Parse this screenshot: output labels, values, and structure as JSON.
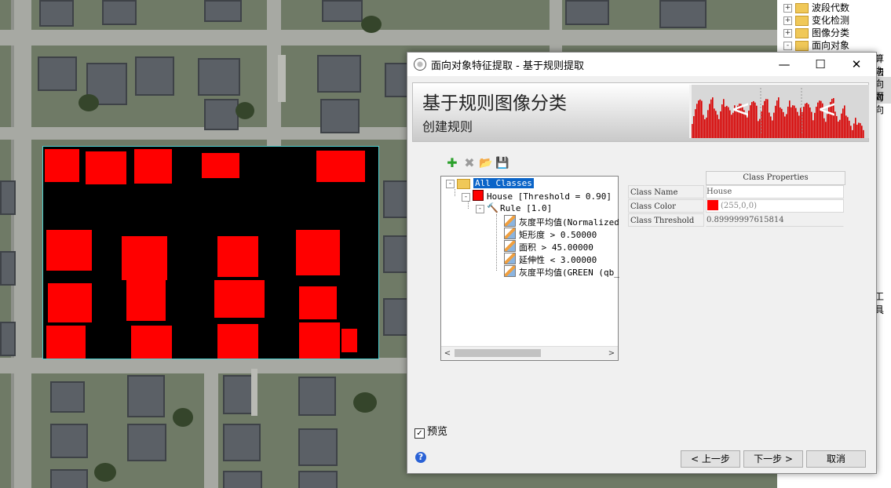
{
  "side_tree": {
    "items": [
      {
        "expander": "+",
        "label": "波段代数"
      },
      {
        "expander": "+",
        "label": "变化检测"
      },
      {
        "expander": "+",
        "label": "图像分类"
      },
      {
        "expander": "-",
        "label": "面向对象"
      }
    ],
    "fragments": [
      "算法",
      "向对",
      "向对",
      "面向",
      "工具"
    ]
  },
  "dialog": {
    "title": "面向对象特征提取 - 基于规则提取",
    "minimize": "—",
    "maximize": "☐",
    "close": "✕",
    "banner_title": "基于规则图像分类",
    "banner_subtitle": "创建规则",
    "histogram_marks": [
      "<",
      "<"
    ],
    "toolbar": {
      "add_icon": "✚",
      "delete_icon": "✖",
      "open_icon": "📂",
      "save_icon": "💾"
    },
    "tree": {
      "root": "All Classes",
      "class_label": "House [Threshold = 0.90]",
      "rule_label": "Rule [1.0]",
      "features": [
        "灰度平均值(Normalized",
        "矩形度 > 0.50000",
        "面积 > 45.00000",
        "延伸性 < 3.00000",
        "灰度平均值(GREEN (qb_"
      ]
    },
    "props": {
      "header": "Class Properties",
      "rows": [
        {
          "label": "Class Name",
          "value": "House"
        },
        {
          "label": "Class Color",
          "value": "(255,0,0)"
        },
        {
          "label": "Class Threshold",
          "value": "0.89999997615814"
        }
      ]
    },
    "preview_label": "预览",
    "preview_checked": true,
    "help": "?",
    "back_button": "< 上一步",
    "next_button": "下一步 >",
    "cancel_button": "取消"
  },
  "colors": {
    "class_color": "#ff0000",
    "selection": "#0a64c8"
  }
}
